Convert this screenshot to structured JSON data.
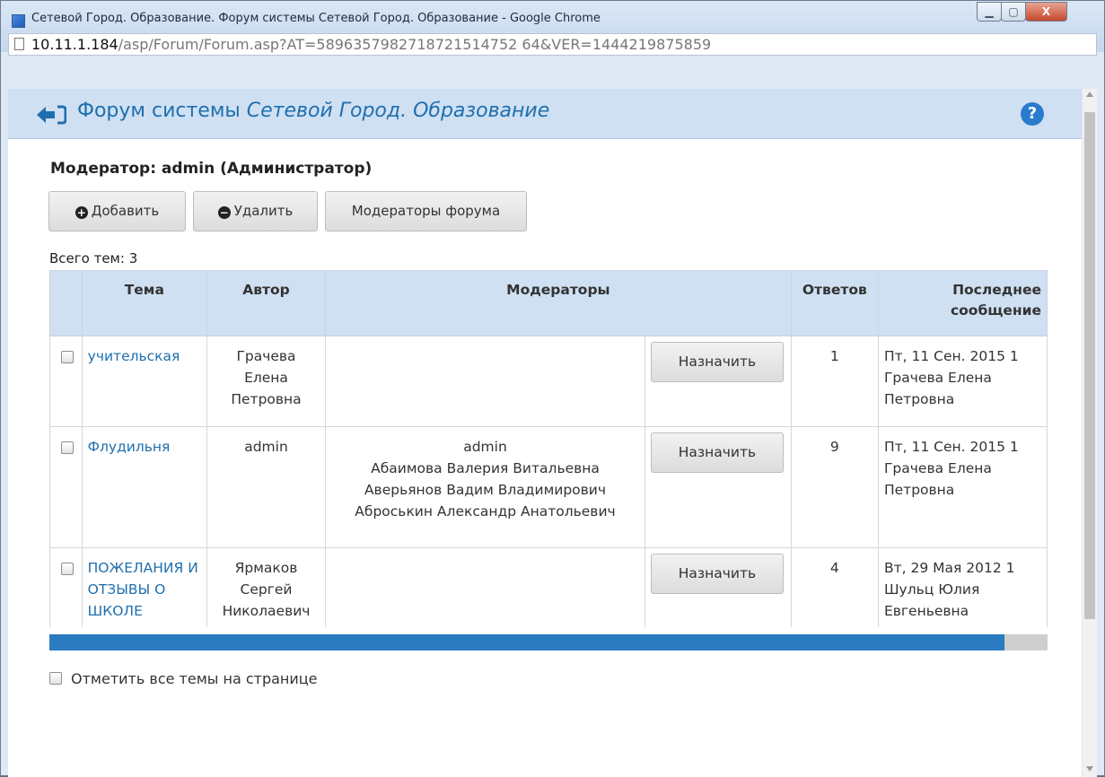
{
  "window": {
    "title": "Сетевой Город. Образование. Форум системы Сетевой Город. Образование - Google Chrome",
    "min_label": "▁",
    "max_label": "▢",
    "close_label": "X"
  },
  "address": {
    "host": "10.11.1.184",
    "path": "/asp/Forum/Forum.asp?AT=5896357982718721514752 64&VER=1444219875859"
  },
  "header": {
    "title_prefix": "Форум системы ",
    "title_italic": "Сетевой Город. Образование",
    "help_label": "?"
  },
  "moderator_line": "Модератор: admin (Администратор)",
  "toolbar": {
    "add_label": "Добавить",
    "add_icon": "+",
    "delete_label": "Удалить",
    "delete_icon": "−",
    "moderators_label": "Модераторы форума"
  },
  "total_topics": "Всего тем: 3",
  "table": {
    "headers": {
      "topic": "Тема",
      "author": "Автор",
      "moderators": "Модераторы",
      "replies": "Ответов",
      "last": "Последнее сообщение"
    },
    "assign_label": "Назначить",
    "rows": [
      {
        "topic": "учительская",
        "author": "Грачева Елена Петровна",
        "moderators": [
          "",
          "",
          "",
          ""
        ],
        "replies": "1",
        "last_date": "Пт, 11 Сен. 2015 1",
        "last_author": "Грачева Елена Петровна"
      },
      {
        "topic": "Флудильня",
        "author": "admin",
        "moderators": [
          "admin",
          "Абаимова Валерия Витальевна",
          "Аверьянов Вадим Владимирович",
          "Аброськин Александр Анатольевич"
        ],
        "replies": "9",
        "last_date": "Пт, 11 Сен. 2015 1",
        "last_author": "Грачева Елена Петровна"
      },
      {
        "topic": "ПОЖЕЛАНИЯ И ОТЗЫВЫ О ШКОЛЕ",
        "author": "Ярмаков Сергей Николаевич",
        "moderators": [
          "",
          "",
          "",
          ""
        ],
        "replies": "4",
        "last_date": "Вт, 29 Мая 2012 1",
        "last_author": "Шульц Юлия Евгеньевна"
      }
    ]
  },
  "select_all_label": "Отметить все темы на странице"
}
